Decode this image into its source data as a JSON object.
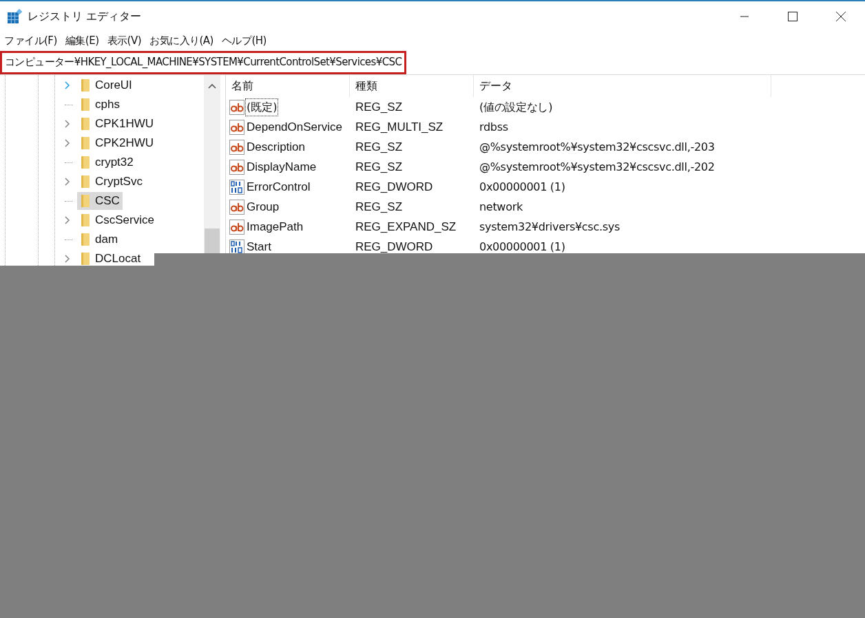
{
  "window": {
    "title": "レジストリ エディター"
  },
  "menu": [
    "ファイル(F)",
    "編集(E)",
    "表示(V)",
    "お気に入り(A)",
    "ヘルプ(H)"
  ],
  "address": {
    "value": "コンピューター¥HKEY_LOCAL_MACHINE¥SYSTEM¥CurrentControlSet¥Services¥CSC",
    "highlighted": true
  },
  "tree": [
    {
      "label": "CoreUI",
      "expandable": true,
      "hover": true,
      "selected": false
    },
    {
      "label": "cphs",
      "expandable": false,
      "hover": false,
      "selected": false
    },
    {
      "label": "CPK1HWU",
      "expandable": true,
      "hover": false,
      "selected": false
    },
    {
      "label": "CPK2HWU",
      "expandable": true,
      "hover": false,
      "selected": false
    },
    {
      "label": "crypt32",
      "expandable": false,
      "hover": false,
      "selected": false
    },
    {
      "label": "CryptSvc",
      "expandable": true,
      "hover": false,
      "selected": false
    },
    {
      "label": "CSC",
      "expandable": false,
      "hover": false,
      "selected": true
    },
    {
      "label": "CscService",
      "expandable": true,
      "hover": false,
      "selected": false
    },
    {
      "label": "dam",
      "expandable": false,
      "hover": false,
      "selected": false
    },
    {
      "label": "DCLocat",
      "expandable": true,
      "hover": false,
      "selected": false
    }
  ],
  "table": {
    "columns": [
      "名前",
      "種類",
      "データ"
    ],
    "rows": [
      {
        "kind": "string",
        "name": "(既定)",
        "type": "REG_SZ",
        "data": "(値の設定なし)",
        "focused": true
      },
      {
        "kind": "string",
        "name": "DependOnService",
        "type": "REG_MULTI_SZ",
        "data": "rdbss",
        "focused": false
      },
      {
        "kind": "string",
        "name": "Description",
        "type": "REG_SZ",
        "data": "@%systemroot%¥system32¥cscsvc.dll,-203",
        "focused": false
      },
      {
        "kind": "string",
        "name": "DisplayName",
        "type": "REG_SZ",
        "data": "@%systemroot%¥system32¥cscsvc.dll,-202",
        "focused": false
      },
      {
        "kind": "binary",
        "name": "ErrorControl",
        "type": "REG_DWORD",
        "data": "0x00000001 (1)",
        "focused": false
      },
      {
        "kind": "string",
        "name": "Group",
        "type": "REG_SZ",
        "data": "network",
        "focused": false
      },
      {
        "kind": "string",
        "name": "ImagePath",
        "type": "REG_EXPAND_SZ",
        "data": "system32¥drivers¥csc.sys",
        "focused": false
      },
      {
        "kind": "binary",
        "name": "Start",
        "type": "REG_DWORD",
        "data": "0x00000001 (1)",
        "focused": false
      }
    ]
  }
}
